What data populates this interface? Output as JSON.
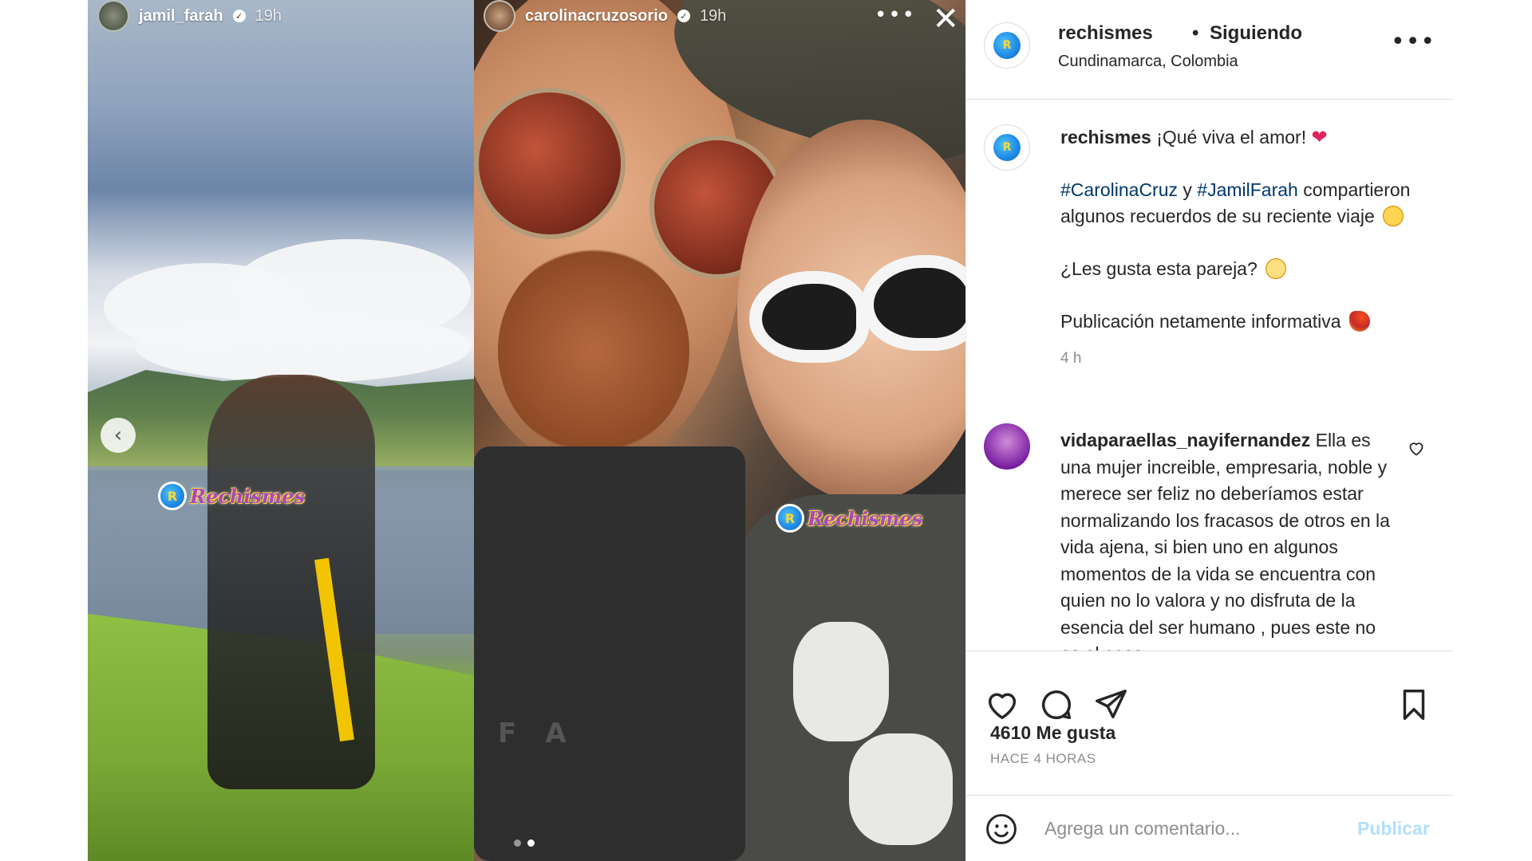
{
  "stories": {
    "left": {
      "username": "jamil_farah",
      "time": "19h"
    },
    "right": {
      "username": "carolinacruzosorio",
      "time": "19h"
    },
    "close_glyph": "✕",
    "more_glyph": "•••",
    "prev_glyph": "‹",
    "watermark_text": "Rechismes",
    "watermark_logo_glyph": "R",
    "hoodie_letters": "FA"
  },
  "post": {
    "username": "rechismes",
    "separator": "•",
    "follow_status": "Siguiendo",
    "location": "Cundinamarca, Colombia",
    "more_glyph": "•••",
    "avatar_glyph": "R",
    "caption": {
      "username": "rechismes",
      "line1": "¡Qué viva el amor!",
      "heart": "❤",
      "hashtag1": "#CarolinaCruz",
      "and": " y ",
      "hashtag2": "#JamilFarah",
      "line2": "compartieron algunos recuerdos de su reciente viaje",
      "line3": "¿Les gusta esta pareja?",
      "line4": "Publicación netamente informativa",
      "time": "4 h"
    },
    "comment": {
      "username": "vidaparaellas_nayifernandez",
      "text": "Ella es una mujer increible, empresaria, noble y merece ser feliz no deberíamos estar normalizando los fracasos de otros en la vida ajena, si bien uno en algunos momentos de la vida se encuentra con quien no lo valora y no disfruta de la esencia del ser humano , pues este no es el caso"
    },
    "likes": "4610 Me gusta",
    "time_ago": "HACE 4 HORAS",
    "comment_box": {
      "placeholder": "Agrega un comentario...",
      "publish_label": "Publicar"
    }
  },
  "colors": {
    "hashtag": "#00376b",
    "publish_disabled": "#b2dffc",
    "muted": "#8e8e8e",
    "text": "#262626"
  }
}
